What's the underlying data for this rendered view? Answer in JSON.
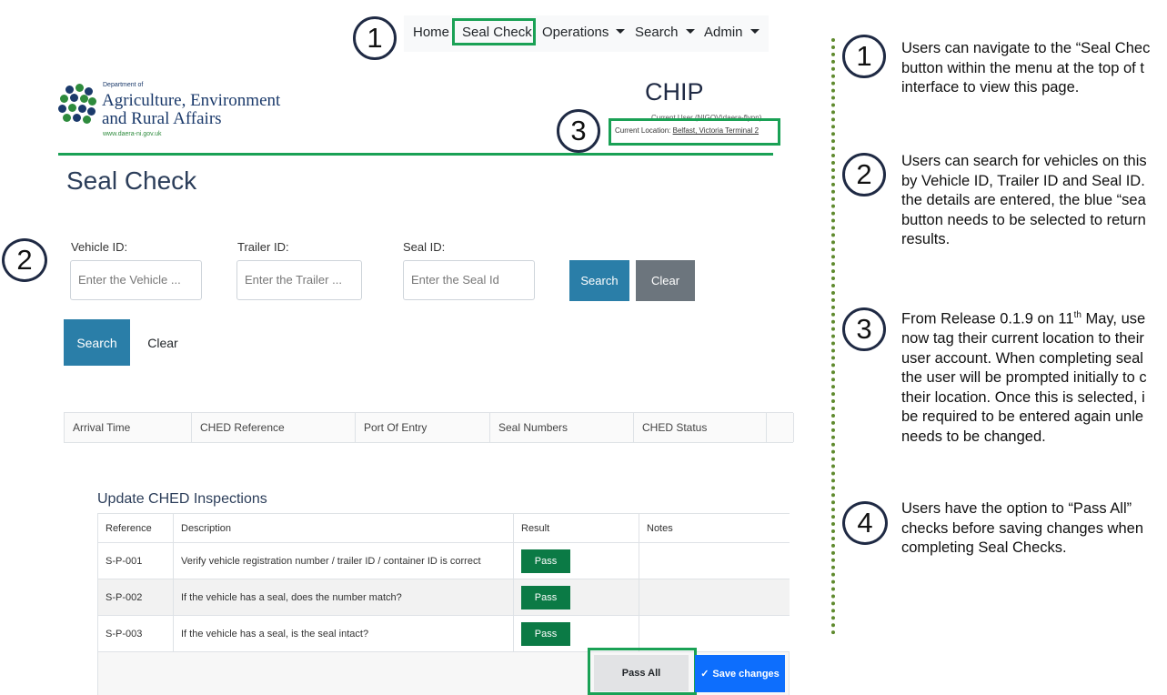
{
  "nav": {
    "items": [
      {
        "label": "Home",
        "dropdown": false
      },
      {
        "label": "Seal Check",
        "dropdown": false
      },
      {
        "label": "Operations",
        "dropdown": true
      },
      {
        "label": "Search",
        "dropdown": true
      },
      {
        "label": "Admin",
        "dropdown": true
      }
    ]
  },
  "logo": {
    "dept_small": "Department of",
    "line1": "Agriculture, Environment",
    "line2": "and Rural Affairs",
    "url": "www.daera-ni.gov.uk"
  },
  "header": {
    "app_name": "CHIP",
    "current_user": "Current User (NIGOV\\daera-flynn)",
    "location_label": "Current Location:",
    "location_value": "Belfast, Victoria Terminal 2"
  },
  "page": {
    "title": "Seal Check"
  },
  "form": {
    "vehicle_label": "Vehicle ID:",
    "vehicle_placeholder": "Enter the Vehicle ...",
    "trailer_label": "Trailer ID:",
    "trailer_placeholder": "Enter the Trailer ...",
    "seal_label": "Seal ID:",
    "seal_placeholder": "Enter the Seal Id",
    "search_label": "Search",
    "clear_label": "Clear",
    "search2_label": "Search",
    "clear2_label": "Clear"
  },
  "results_table": {
    "headers": [
      "Arrival Time",
      "CHED Reference",
      "Port Of Entry",
      "Seal Numbers",
      "CHED Status"
    ]
  },
  "inspections": {
    "title": "Update CHED Inspections",
    "headers": [
      "Reference",
      "Description",
      "Result",
      "Notes"
    ],
    "rows": [
      {
        "ref": "S-P-001",
        "desc": "Verify vehicle registration number / trailer ID / container ID is correct",
        "result": "Pass"
      },
      {
        "ref": "S-P-002",
        "desc": "If the vehicle has a seal, does the number match?",
        "result": "Pass"
      },
      {
        "ref": "S-P-003",
        "desc": "If the vehicle has a seal, is the seal intact?",
        "result": "Pass"
      }
    ],
    "pass_all_label": "Pass All",
    "save_label": "Save changes"
  },
  "callouts": {
    "badges": [
      "1",
      "2",
      "3",
      "4"
    ],
    "left_badges": [
      "1",
      "2",
      "3"
    ],
    "notes": [
      [
        "Users can navigate to the “Seal Chec",
        "button within the menu at the top of t",
        "interface to view this page."
      ],
      [
        "Users can search for vehicles on this",
        "by Vehicle ID, Trailer ID and Seal ID.",
        "the details are entered, the blue “sea",
        "button needs to be selected to return",
        "results."
      ],
      [
        "From Release 0.1.9 on 11th May, use",
        "now tag their current location to their",
        "user account. When completing seal",
        "the user will be prompted initially to c",
        "their location. Once this is selected, i",
        "be required to be entered again unle",
        "needs to be changed."
      ],
      [
        "Users have the option to “Pass All”",
        "checks before saving changes when",
        "completing Seal Checks."
      ]
    ]
  },
  "colors": {
    "highlight": "#1aa155",
    "primary": "#2a7ea8",
    "secondary": "#6c757d",
    "pass": "#0b7a45",
    "save": "#0d6efd",
    "navy": "#1f2a44"
  }
}
